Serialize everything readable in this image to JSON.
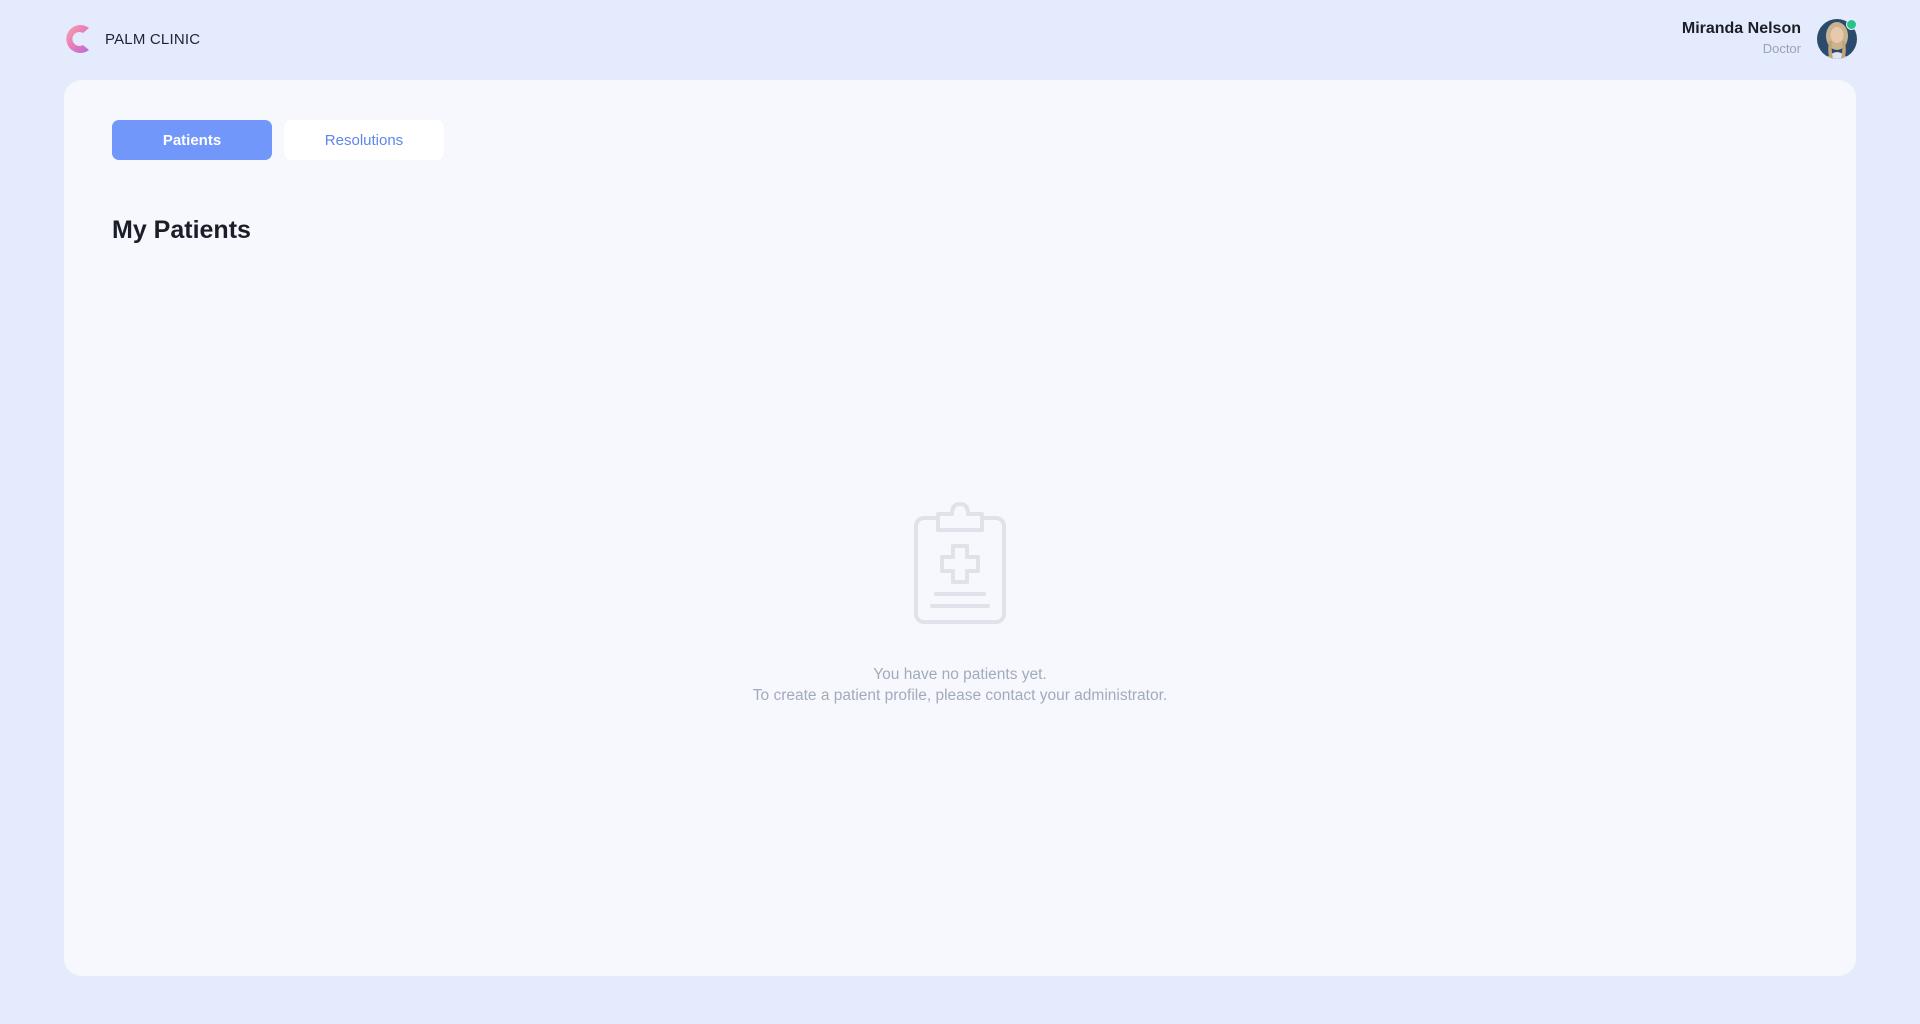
{
  "brand": {
    "name": "PALM CLINIC",
    "logo_icon": "palm-clinic-logo-icon",
    "logo_colors": [
      "#f08ab4",
      "#c76bd8",
      "#f4a0a8"
    ]
  },
  "user": {
    "name": "Miranda Nelson",
    "role": "Doctor",
    "status": "online",
    "status_color": "#27c489"
  },
  "tabs": [
    {
      "label": "Patients",
      "active": true
    },
    {
      "label": "Resolutions",
      "active": false
    }
  ],
  "main": {
    "title": "My Patients",
    "empty_state": {
      "icon": "clipboard-medical-icon",
      "line1": "You have no patients yet.",
      "line2": "To create a patient profile, please contact your administrator."
    }
  },
  "colors": {
    "page_background": "#e4ebfc",
    "card_background": "#f6f8fe",
    "accent": "#7197fb",
    "muted_text": "#a2aabb"
  }
}
